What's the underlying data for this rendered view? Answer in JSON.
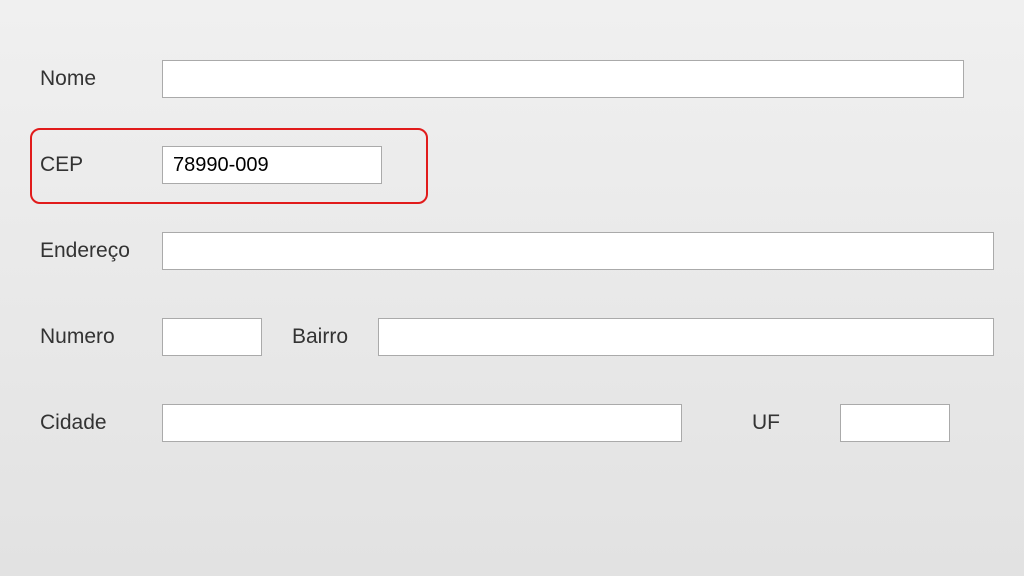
{
  "form": {
    "nome": {
      "label": "Nome",
      "value": ""
    },
    "cep": {
      "label": "CEP",
      "value": "78990-009"
    },
    "endereco": {
      "label": "Endereço",
      "value": ""
    },
    "numero": {
      "label": "Numero",
      "value": ""
    },
    "bairro": {
      "label": "Bairro",
      "value": ""
    },
    "cidade": {
      "label": "Cidade",
      "value": ""
    },
    "uf": {
      "label": "UF",
      "value": ""
    }
  },
  "highlight": {
    "field": "cep",
    "color": "#e11b1b"
  }
}
